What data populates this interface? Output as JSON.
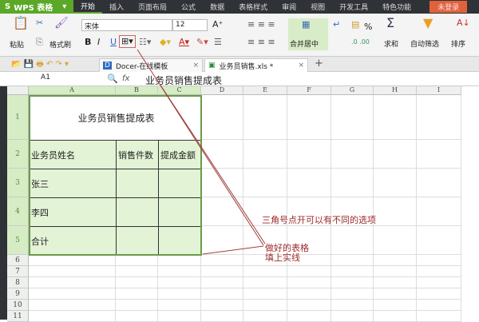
{
  "app": {
    "name": "WPS 表格",
    "logo": "S"
  },
  "menu": [
    "开始",
    "插入",
    "页面布局",
    "公式",
    "数据",
    "表格样式",
    "审阅",
    "视图",
    "开发工具",
    "特色功能"
  ],
  "login": "未登录",
  "ribbon": {
    "paste": "粘贴",
    "format_painter": "格式刷",
    "font": "宋体",
    "size": "12",
    "merge": "合并居中",
    "sum": "求和",
    "filter": "自动筛选",
    "sort": "排序",
    "bold": "B",
    "italic": "I",
    "underline": "U",
    "percent": "%"
  },
  "tabs": [
    {
      "label": "Docer-在线模板"
    },
    {
      "label": "业务员销售.xls *"
    }
  ],
  "formula": {
    "cell_ref": "A1",
    "fx": "fx",
    "value": "业务员销售提成表"
  },
  "columns": [
    "A",
    "B",
    "C",
    "D",
    "E",
    "F",
    "G",
    "H",
    "I"
  ],
  "rows": [
    "1",
    "2",
    "3",
    "4",
    "5",
    "6",
    "7",
    "8",
    "9",
    "10",
    "11"
  ],
  "table": {
    "title": "业务员销售提成表",
    "headers": [
      "业务员姓名",
      "销售件数",
      "提成金额"
    ],
    "names": [
      "张三",
      "李四",
      "合计"
    ]
  },
  "annotations": {
    "note1": "三角号点开可以有不同的选项",
    "note2_line1": "做好的表格",
    "note2_line2": "填上实线"
  }
}
